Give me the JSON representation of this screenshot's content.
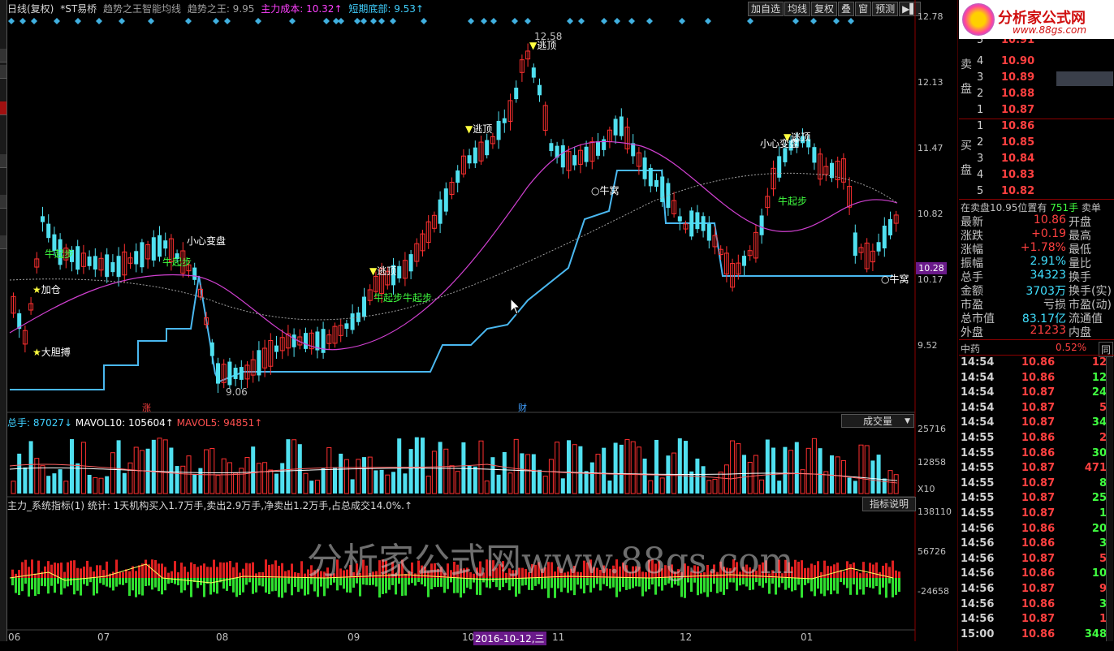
{
  "header": {
    "period": "日线(复权)",
    "stock": "*ST易桥",
    "indicator1": "趋势之王智能均线",
    "indicator2": "趋势之王: 9.95",
    "cost": "主力成本: 10.32↑",
    "bottom": "短期底部: 9.53↑"
  },
  "toolbar": {
    "add_fav": "加自选",
    "ma": "均线",
    "adjust": "复权",
    "overlay": "叠",
    "window": "窗",
    "forecast": "预测",
    "flag": "▶▌"
  },
  "price_axis": [
    "12.78",
    "12.13",
    "11.47",
    "10.82",
    "10.17",
    "9.52"
  ],
  "current_price_tag": "10.28",
  "price_high_label": "12.58",
  "price_low_label": "9.06",
  "annotations": {
    "escape_top": "逃顶",
    "careful": "小心变盘",
    "bull_start": "牛起步",
    "bull_nest": "牛窝",
    "add_pos": "加仓",
    "bold": "大胆搏",
    "bull_double": "牛起步牛起步",
    "zhang": "涨",
    "cai": "财"
  },
  "volume": {
    "label": "总手: 87027↓",
    "mavol10": "MAVOL10: 105604↑",
    "mavol5": "MAVOL5: 94851↑",
    "dropdown": "成交量",
    "axis": [
      "25716",
      "12858",
      "X10"
    ]
  },
  "system": {
    "label": "主力_系统指标(1) 统计: 1天机构买入1.7万手,卖出2.9万手,净卖出1.2万手,占总成交14.0%.↑",
    "help": "指标说明",
    "axis": [
      "138110",
      "56726",
      "-24658"
    ]
  },
  "x_axis": [
    "06",
    "07",
    "08",
    "09",
    "10",
    "2016-10-12,三",
    "11",
    "12",
    "01"
  ],
  "watermark": "分析家公式网www.88gs.com",
  "logo": {
    "title": "分析家公式网",
    "url": "www.88gs.com"
  },
  "orderbook": {
    "sell_label": [
      "卖",
      "盘"
    ],
    "buy_label": [
      "买",
      "盘"
    ],
    "sell": [
      {
        "lv": "5",
        "pr": "10.91"
      },
      {
        "lv": "4",
        "pr": "10.90"
      },
      {
        "lv": "3",
        "pr": "10.89"
      },
      {
        "lv": "2",
        "pr": "10.88"
      },
      {
        "lv": "1",
        "pr": "10.87"
      }
    ],
    "buy": [
      {
        "lv": "1",
        "pr": "10.86"
      },
      {
        "lv": "2",
        "pr": "10.85"
      },
      {
        "lv": "3",
        "pr": "10.84"
      },
      {
        "lv": "4",
        "pr": "10.83"
      },
      {
        "lv": "5",
        "pr": "10.82"
      }
    ],
    "position_text": "在卖盘10.95位置有",
    "position_qty": "751手",
    "position_act": "卖单"
  },
  "quote": [
    {
      "k": "最新",
      "v": "10.86",
      "c": "#ff4040",
      "k2": "开盘"
    },
    {
      "k": "涨跌",
      "v": "+0.19",
      "c": "#ff4040",
      "k2": "最高"
    },
    {
      "k": "涨幅",
      "v": "+1.78%",
      "c": "#ff4040",
      "k2": "最低"
    },
    {
      "k": "振幅",
      "v": "2.91%",
      "c": "#40e0ff",
      "k2": "量比"
    },
    {
      "k": "总手",
      "v": "34323",
      "c": "#40e0ff",
      "k2": "换手"
    },
    {
      "k": "金额",
      "v": "3703万",
      "c": "#40e0ff",
      "k2": "换手(实)"
    },
    {
      "k": "市盈",
      "v": "亏损",
      "c": "#c0c0c0",
      "k2": "市盈(动)"
    },
    {
      "k": "总市值",
      "v": "83.17亿",
      "c": "#40e0ff",
      "k2": "流通值"
    },
    {
      "k": "外盘",
      "v": "21233",
      "c": "#ff4040",
      "k2": "内盘"
    }
  ],
  "sector": {
    "name": "中药",
    "pct": "0.52%",
    "tag": "同"
  },
  "ticks": [
    {
      "t": "14:54",
      "p": "10.86",
      "q": "12",
      "c": "#ff4040"
    },
    {
      "t": "14:54",
      "p": "10.86",
      "q": "12",
      "c": "#40ff40"
    },
    {
      "t": "14:54",
      "p": "10.87",
      "q": "24",
      "c": "#40ff40"
    },
    {
      "t": "14:54",
      "p": "10.87",
      "q": "5",
      "c": "#ff4040"
    },
    {
      "t": "14:54",
      "p": "10.87",
      "q": "34",
      "c": "#40ff40"
    },
    {
      "t": "14:55",
      "p": "10.86",
      "q": "2",
      "c": "#ff4040"
    },
    {
      "t": "14:55",
      "p": "10.86",
      "q": "30",
      "c": "#40ff40"
    },
    {
      "t": "14:55",
      "p": "10.87",
      "q": "471",
      "c": "#ff4040"
    },
    {
      "t": "14:55",
      "p": "10.87",
      "q": "8",
      "c": "#40ff40"
    },
    {
      "t": "14:55",
      "p": "10.87",
      "q": "25",
      "c": "#40ff40"
    },
    {
      "t": "14:55",
      "p": "10.87",
      "q": "1",
      "c": "#40ff40"
    },
    {
      "t": "14:56",
      "p": "10.86",
      "q": "20",
      "c": "#40ff40"
    },
    {
      "t": "14:56",
      "p": "10.86",
      "q": "3",
      "c": "#40ff40"
    },
    {
      "t": "14:56",
      "p": "10.87",
      "q": "5",
      "c": "#ff4040"
    },
    {
      "t": "14:56",
      "p": "10.86",
      "q": "10",
      "c": "#40ff40"
    },
    {
      "t": "14:56",
      "p": "10.87",
      "q": "9",
      "c": "#ff4040"
    },
    {
      "t": "14:56",
      "p": "10.86",
      "q": "3",
      "c": "#40ff40"
    },
    {
      "t": "14:56",
      "p": "10.87",
      "q": "1",
      "c": "#ff4040"
    },
    {
      "t": "15:00",
      "p": "10.86",
      "q": "348",
      "c": "#40ff40"
    }
  ],
  "colors": {
    "up": "#ff3030",
    "down": "#50e0f0",
    "ma_pink": "#d040d0",
    "trend": "#40b0ff"
  }
}
